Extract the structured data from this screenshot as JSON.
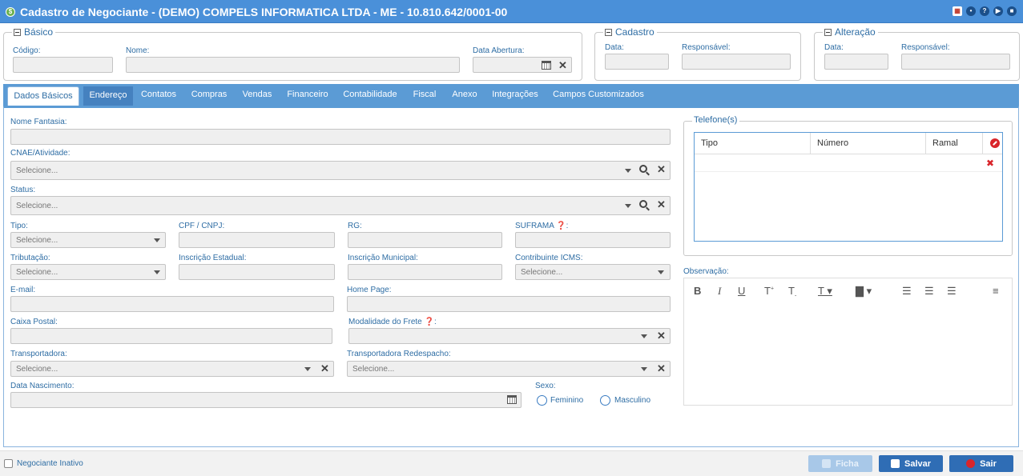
{
  "window": {
    "title": "Cadastro de Negociante - (DEMO) COMPELS INFORMATICA LTDA - ME - 10.810.642/0001-00"
  },
  "basico": {
    "legend": "Básico",
    "codigo_label": "Código:",
    "codigo_value": "",
    "nome_label": "Nome:",
    "nome_value": "",
    "data_abertura_label": "Data Abertura:",
    "data_abertura_value": ""
  },
  "cadastro": {
    "legend": "Cadastro",
    "data_label": "Data:",
    "responsavel_label": "Responsável:"
  },
  "alteracao": {
    "legend": "Alteração",
    "data_label": "Data:",
    "responsavel_label": "Responsável:"
  },
  "tabs": [
    {
      "label": "Dados Básicos",
      "active": true
    },
    {
      "label": "Endereço"
    },
    {
      "label": "Contatos"
    },
    {
      "label": "Compras"
    },
    {
      "label": "Vendas"
    },
    {
      "label": "Financeiro"
    },
    {
      "label": "Contabilidade"
    },
    {
      "label": "Fiscal"
    },
    {
      "label": "Anexo"
    },
    {
      "label": "Integrações"
    },
    {
      "label": "Campos Customizados"
    }
  ],
  "form": {
    "nome_fantasia_label": "Nome Fantasia:",
    "cnae_label": "CNAE/Atividade:",
    "select_placeholder": "Selecione...",
    "status_label": "Status:",
    "tipo_label": "Tipo:",
    "cpf_cnpj_label": "CPF / CNPJ:",
    "rg_label": "RG:",
    "suframa_label": "SUFRAMA",
    "tributacao_label": "Tributação:",
    "inscricao_estadual_label": "Inscrição Estadual:",
    "inscricao_municipal_label": "Inscrição Municipal:",
    "contribuinte_icms_label": "Contribuinte ICMS:",
    "email_label": "E-mail:",
    "home_page_label": "Home Page:",
    "caixa_postal_label": "Caixa Postal:",
    "modalidade_frete_label": "Modalidade do Frete",
    "transportadora_label": "Transportadora:",
    "transportadora_redespacho_label": "Transportadora Redespacho:",
    "data_nascimento_label": "Data Nascimento:",
    "sexo_label": "Sexo:",
    "sexo_options": [
      "Feminino",
      "Masculino"
    ],
    "colon": ":"
  },
  "telefones": {
    "legend": "Telefone(s)",
    "columns": [
      "Tipo",
      "Número",
      "Ramal"
    ]
  },
  "observacao": {
    "label": "Observação:"
  },
  "footer": {
    "inativo_label": "Negociante Inativo",
    "ficha_label": "Ficha",
    "salvar_label": "Salvar",
    "sair_label": "Sair"
  },
  "colors": {
    "titlebar": "#4a90d9",
    "tabbar": "#5b9bd5",
    "salvar": "#2f6db5",
    "sair": "#2f6db5",
    "ficha_disabled": "#a8c8e8"
  }
}
